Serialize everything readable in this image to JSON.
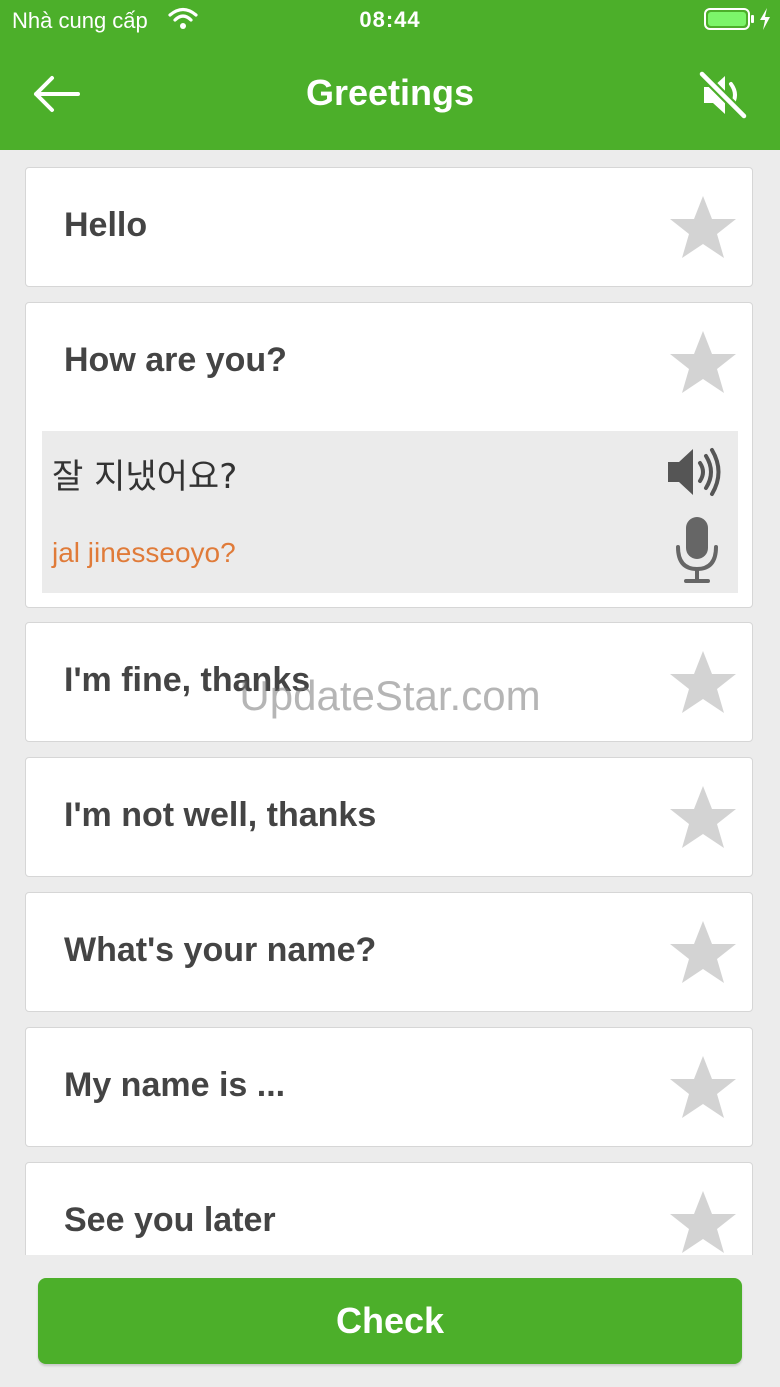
{
  "status_bar": {
    "carrier": "Nhà cung cấp",
    "time": "08:44"
  },
  "header": {
    "title": "Greetings",
    "back_icon": "arrow-left-icon",
    "sound_icon": "speaker-muted-icon"
  },
  "phrases": [
    {
      "text": "Hello"
    },
    {
      "text": "How are you?",
      "expanded": true,
      "translation": "잘 지냈어요?",
      "romanization": "jal jinesseoyo?"
    },
    {
      "text": "I'm fine, thanks"
    },
    {
      "text": "I'm not well, thanks"
    },
    {
      "text": "What's your name?"
    },
    {
      "text": "My name is ..."
    },
    {
      "text": "See you later"
    }
  ],
  "watermark": "UpdateStar.com",
  "footer": {
    "check_label": "Check"
  },
  "colors": {
    "brand_green": "#4caf2a",
    "romanization": "#e07b39",
    "star_gray": "#d3d3d3"
  }
}
